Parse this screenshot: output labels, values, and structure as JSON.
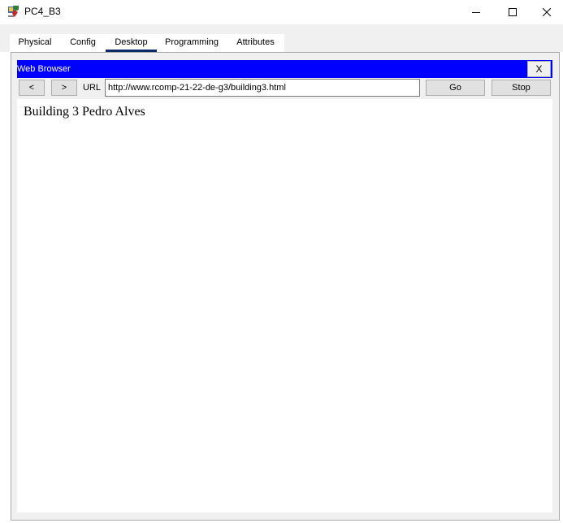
{
  "window": {
    "title": "PC4_B3",
    "icon": "packet-tracer-pc-icon"
  },
  "window_controls": {
    "minimize_icon": "minimize-icon",
    "maximize_icon": "maximize-icon",
    "close_icon": "close-icon"
  },
  "tabs": [
    {
      "label": "Physical"
    },
    {
      "label": "Config"
    },
    {
      "label": "Desktop",
      "active": true
    },
    {
      "label": "Programming"
    },
    {
      "label": "Attributes"
    }
  ],
  "browser": {
    "title": "Web Browser",
    "close_label": "X",
    "back_label": "<",
    "forward_label": ">",
    "url_label": "URL",
    "url_value": "http://www.rcomp-21-22-de-g3/building3.html",
    "go_label": "Go",
    "stop_label": "Stop",
    "page_text": "Building 3 Pedro Alves"
  },
  "colors": {
    "browser_titlebar": "#0000ff",
    "active_tab_underline": "#0b2a66"
  }
}
